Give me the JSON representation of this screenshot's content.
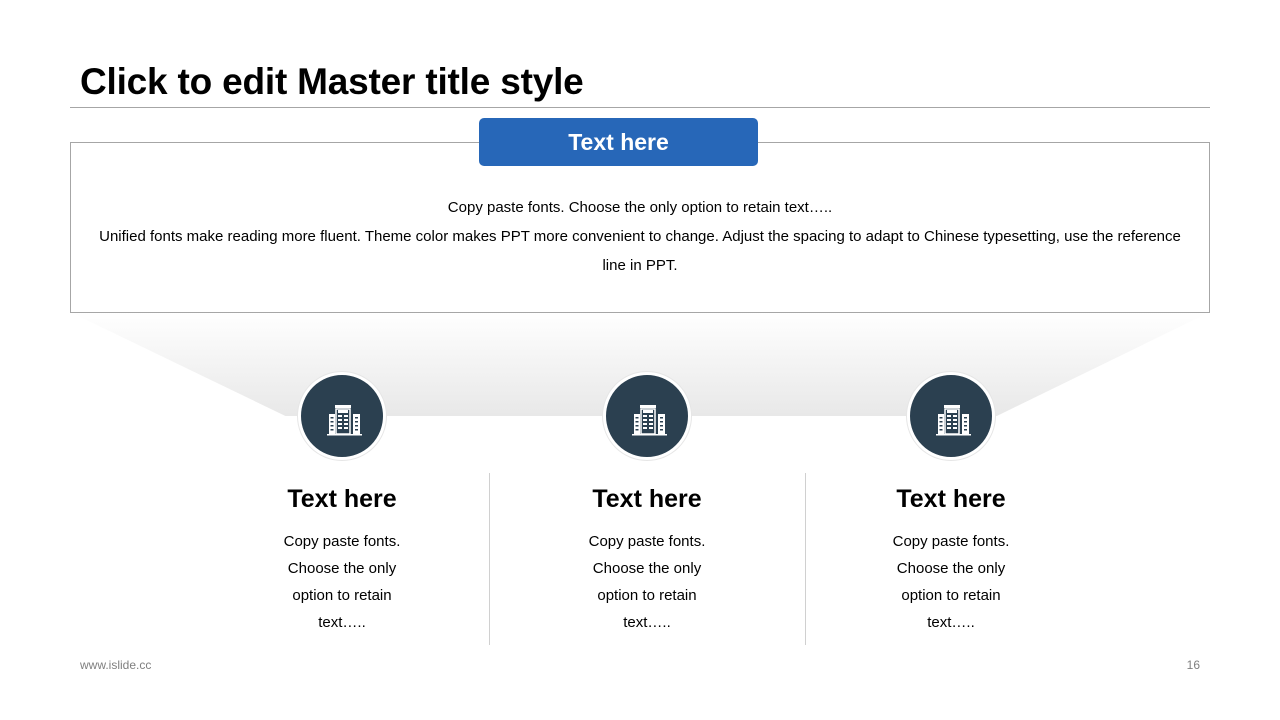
{
  "slide": {
    "title": "Click to edit Master title style",
    "tag_label": "Text here",
    "body_line_1": "Copy paste fonts. Choose the only option to retain text…..",
    "body_line_2": "Unified fonts make reading more fluent. Theme color makes PPT more convenient to change. Adjust the spacing to adapt to Chinese typesetting, use the reference line in PPT.",
    "items": [
      {
        "icon": "office-building-icon",
        "title": "Text here",
        "description": "Copy paste fonts. Choose the only option to retain text….."
      },
      {
        "icon": "office-building-icon",
        "title": "Text here",
        "description": "Copy paste fonts. Choose the only option to retain text….."
      },
      {
        "icon": "office-building-icon",
        "title": "Text here",
        "description": "Copy paste fonts. Choose the only option to retain text….."
      }
    ]
  },
  "footer": {
    "url": "www.islide.cc",
    "page_number": "16"
  },
  "colors": {
    "accent_blue": "#2767b8",
    "icon_circle": "#2b4050",
    "rule_gray": "#a6a6a6",
    "footer_text": "#7f7f7f"
  }
}
